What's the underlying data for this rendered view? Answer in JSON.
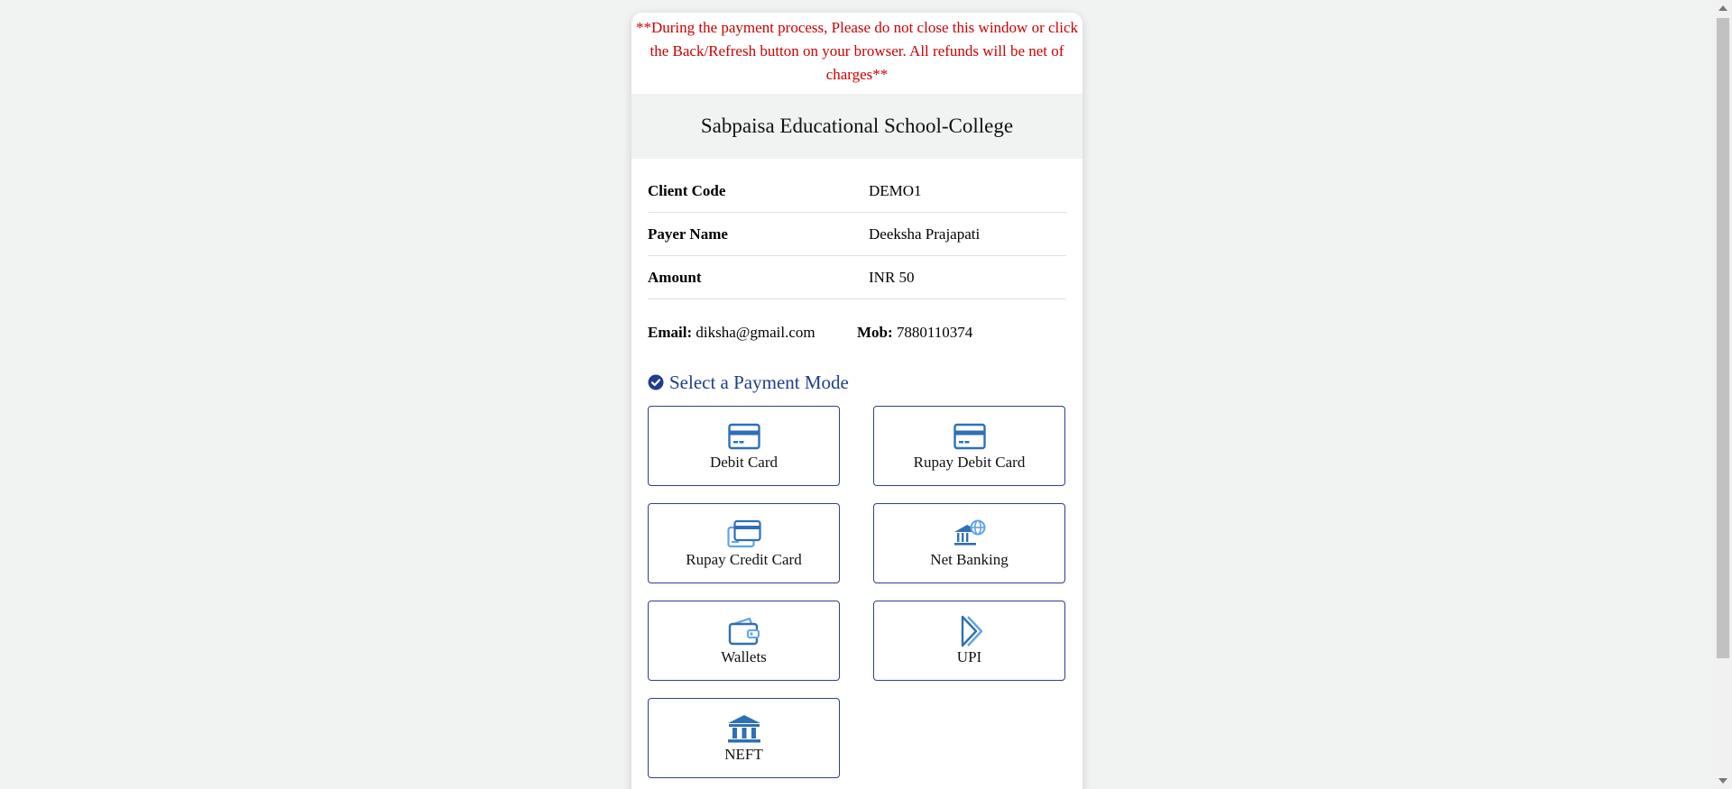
{
  "warning": "**During the payment process, Please do not close this window or click the Back/Refresh button on your browser. All refunds will be net of charges**",
  "merchant_name": "Sabpaisa Educational School-College",
  "details": [
    {
      "label": "Client Code",
      "value": "DEMO1"
    },
    {
      "label": "Payer Name",
      "value": "Deeksha Prajapati"
    },
    {
      "label": "Amount",
      "value": "INR 50"
    }
  ],
  "contact": {
    "email_label": "Email:",
    "email": "diksha@gmail.com",
    "mob_label": "Mob:",
    "mob": "7880110374"
  },
  "payment_section": {
    "heading": "Select a Payment Mode",
    "heading_icon": "check-circle-icon",
    "modes": [
      {
        "label": "Debit Card",
        "icon": "card-icon"
      },
      {
        "label": "Rupay Debit Card",
        "icon": "card-icon"
      },
      {
        "label": "Rupay Credit Card",
        "icon": "stacked-card-icon"
      },
      {
        "label": "Net Banking",
        "icon": "bank-globe-icon"
      },
      {
        "label": "Wallets",
        "icon": "wallet-icon"
      },
      {
        "label": "UPI",
        "icon": "upi-icon"
      },
      {
        "label": "NEFT",
        "icon": "bank-building-icon"
      }
    ]
  },
  "colors": {
    "warning": "#cc0000",
    "accent": "#1f3d8f",
    "tile_border": "#2c3f8f",
    "icon_blue": "#2f6fb5"
  }
}
